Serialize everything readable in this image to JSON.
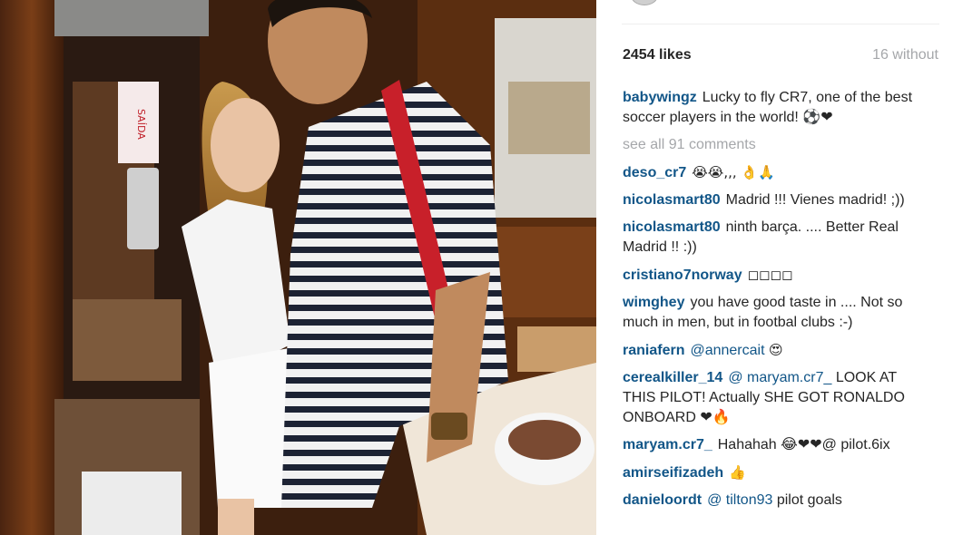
{
  "post": {
    "likes": "2454 likes",
    "time": "16 without"
  },
  "caption": {
    "user": "babywingz",
    "text": "Lucky to fly CR7, one of the best soccer players in the world! ⚽❤"
  },
  "see_all": "see all 91 comments",
  "comments": [
    {
      "user": "deso_cr7",
      "mention": "",
      "text": "😭😭,,, 👌🙏"
    },
    {
      "user": "nicolasmart80",
      "mention": "",
      "text": "Madrid !!! Vienes madrid! ;))"
    },
    {
      "user": "nicolasmart80",
      "mention": "",
      "text": "ninth barça. .... Better Real Madrid !! :))"
    },
    {
      "user": "cristiano7norway",
      "mention": "",
      "text": "◻◻◻◻"
    },
    {
      "user": "wimghey",
      "mention": "",
      "text": "you have good taste in .... Not so much in men, but in footbal clubs :-)"
    },
    {
      "user": "raniafern",
      "mention": "@annercait",
      "text": "😍"
    },
    {
      "user": "cerealkiller_14",
      "mention": "@ maryam.cr7_",
      "text": "LOOK AT THIS PILOT! Actually SHE GOT RONALDO ONBOARD ❤🔥"
    },
    {
      "user": "maryam.cr7_",
      "mention": "",
      "text": "Hahahah 😂❤❤@ pilot.6ix"
    },
    {
      "user": "amirseifizadeh",
      "mention": "",
      "text": "👍"
    },
    {
      "user": "danieloordt",
      "mention": "@ tilton93",
      "text": "pilot goals"
    }
  ],
  "photo": {
    "sign_text": "SAÍDA",
    "colors": {
      "wood": "#6a3514",
      "shirt_stripe": "#1c2233",
      "strap": "#c8202a"
    }
  }
}
